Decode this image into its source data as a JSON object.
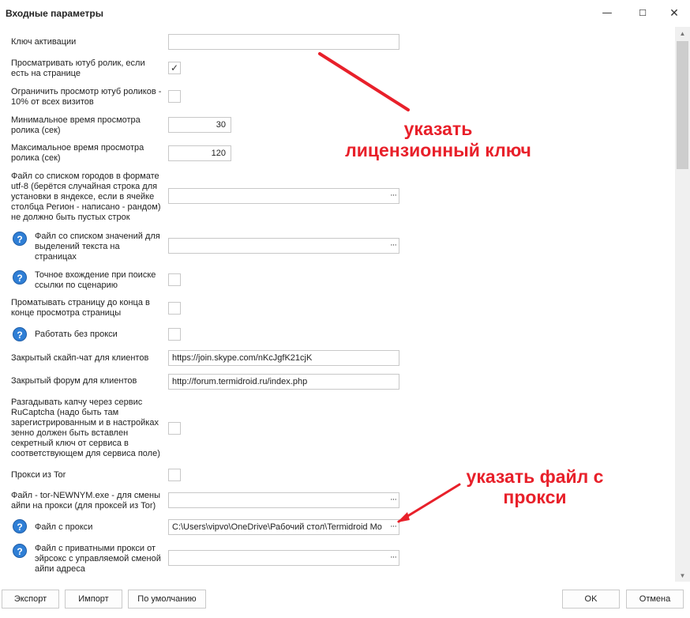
{
  "window": {
    "title": "Входные параметры",
    "controls": {
      "minimize": "—",
      "maximize": "☐",
      "close": "✕"
    }
  },
  "fields": {
    "activation_key": {
      "label": "Ключ активации",
      "value": ""
    },
    "watch_youtube": {
      "label": "Просматривать ютуб ролик, если есть на странице",
      "checked": true,
      "mark": "✓"
    },
    "limit_youtube": {
      "label": "Ограничить просмотр ютуб роликов - 10% от всех визитов",
      "checked": false
    },
    "min_watch_time": {
      "label": "Минимальное время просмотра ролика (сек)",
      "value": "30"
    },
    "max_watch_time": {
      "label": "Максимальное время просмотра ролика (сек)",
      "value": "120"
    },
    "cities_file": {
      "label": "Файл со списком городов в формате utf-8 (берётся случайная строка для установки в яндексе, если в ячейке столбца Регион - написано - рандом) не должно быть пустых строк",
      "value": ""
    },
    "highlight_file": {
      "label": "Файл со списком значений для выделений текста на страницах",
      "value": ""
    },
    "exact_match": {
      "label": "Точное вхождение при поиске ссылки по сценарию",
      "checked": false
    },
    "scroll_page": {
      "label": "Проматывать страницу до конца в конце просмотра страницы",
      "checked": false
    },
    "no_proxy": {
      "label": "Работать без прокси",
      "checked": false
    },
    "skype_chat": {
      "label": "Закрытый скайп-чат для клиентов",
      "value": "https://join.skype.com/nKcJgfK21cjK"
    },
    "forum": {
      "label": "Закрытый форум для клиентов",
      "value": "http://forum.termidroid.ru/index.php"
    },
    "rucaptcha": {
      "label": "Разгадывать капчу через сервис RuCaptcha (надо быть там зарегистрированным и в настройках зенно должен быть вставлен секретный ключ от сервиса в соответствующем для сервиса поле)",
      "checked": false
    },
    "tor_proxy": {
      "label": "Прокси из Tor",
      "checked": false
    },
    "tor_newnym": {
      "label": "Файл - tor-NEWNYM.exe - для смены айпи на прокси (для проксей из Tor)",
      "value": ""
    },
    "proxy_file": {
      "label": "Файл с прокси",
      "value": "C:\\Users\\vipvo\\OneDrive\\Рабочий стол\\Termidroid Mob"
    },
    "private_proxy_file": {
      "label": "Файл с приватными прокси от эйрсокс с управляемой сменой айпи адреса",
      "value": ""
    }
  },
  "help_icon_glyph": "?",
  "file_button_glyph": "···",
  "buttons": {
    "export": "Экспорт",
    "import": "Импорт",
    "defaults": "По умолчанию",
    "ok": "OK",
    "cancel": "Отмена"
  },
  "annotations": {
    "license_key_line1": "указать",
    "license_key_line2": "лицензионный ключ",
    "proxy_file_line1": "указать файл с",
    "proxy_file_line2": "прокси"
  },
  "colors": {
    "annotation": "#e8202a",
    "help_icon": "#2f7fd6"
  }
}
